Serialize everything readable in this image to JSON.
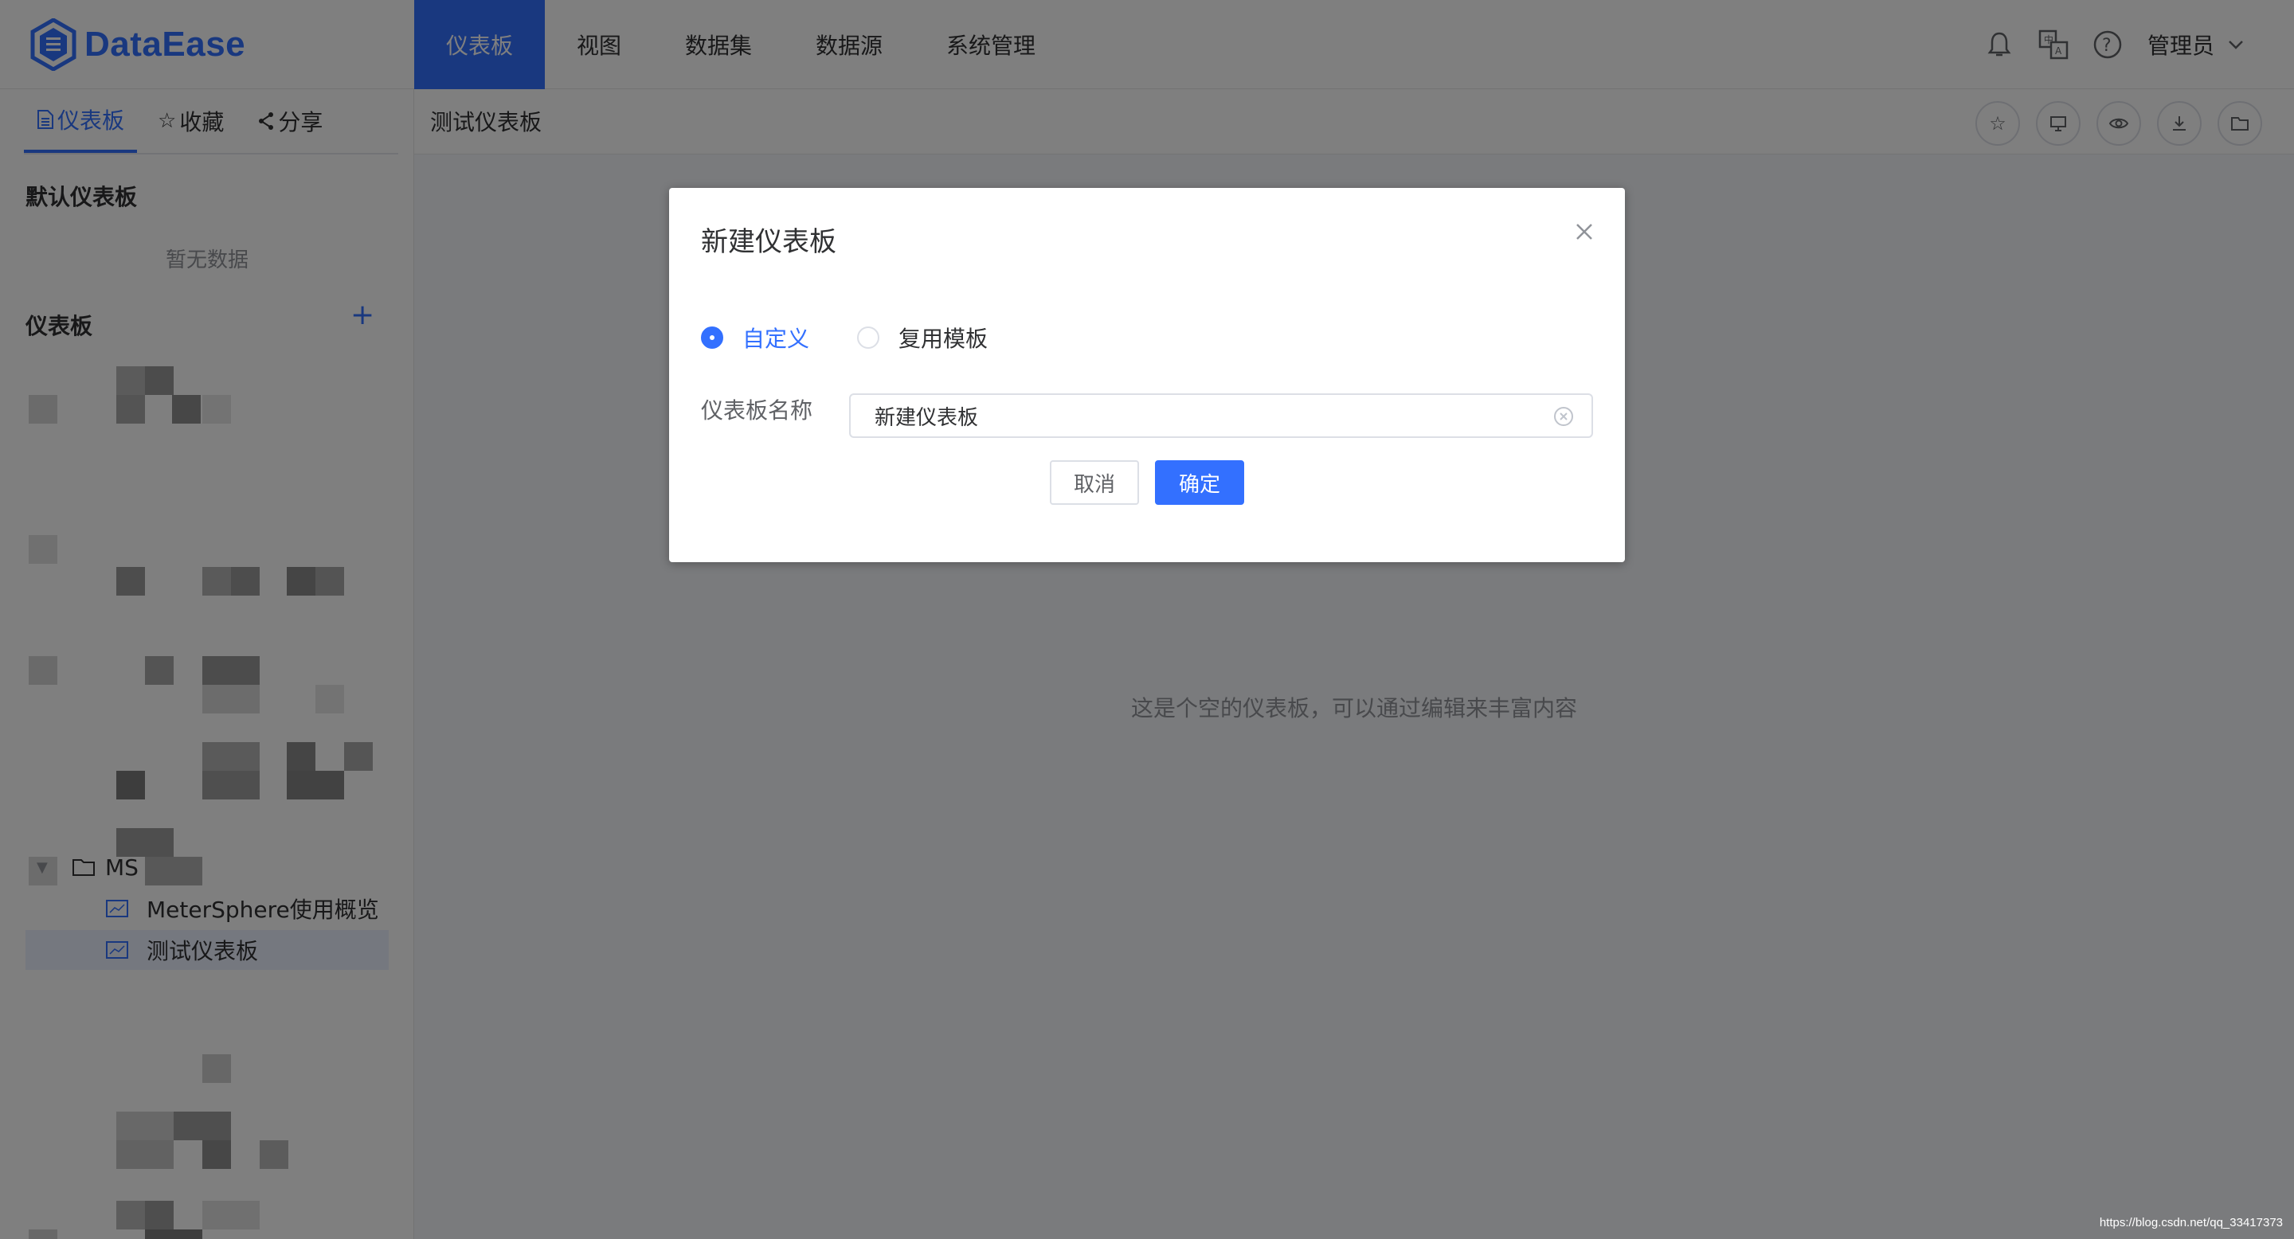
{
  "app": {
    "logo_text": "DataEase"
  },
  "topnav": {
    "items": [
      {
        "label": "仪表板",
        "active": true
      },
      {
        "label": "视图"
      },
      {
        "label": "数据集"
      },
      {
        "label": "数据源"
      },
      {
        "label": "系统管理"
      }
    ],
    "user": "管理员",
    "icons": [
      "bell-icon",
      "translate-icon",
      "help-icon"
    ]
  },
  "sidebar": {
    "tabs": [
      {
        "icon": "document-icon",
        "label": "仪表板",
        "active": true
      },
      {
        "icon": "star-icon",
        "label": "收藏"
      },
      {
        "icon": "share-icon",
        "label": "分享"
      }
    ],
    "default_title": "默认仪表板",
    "default_empty": "暂无数据",
    "panel_title": "仪表板",
    "add_symbol": "+",
    "tree": {
      "folder": "MS",
      "items": [
        {
          "label": "MeterSphere使用概览"
        },
        {
          "label": "测试仪表板",
          "selected": true
        }
      ]
    }
  },
  "main": {
    "title": "测试仪表板",
    "tool_icons": [
      "star-icon",
      "present-icon",
      "eye-icon",
      "download-icon",
      "folder-icon"
    ],
    "empty_text": "这是个空的仪表板，可以通过编辑来丰富内容"
  },
  "dialog": {
    "title": "新建仪表板",
    "radio_options": [
      {
        "label": "自定义",
        "checked": true
      },
      {
        "label": "复用模板",
        "checked": false
      }
    ],
    "name_label": "仪表板名称",
    "name_value": "新建仪表板",
    "cancel_label": "取消",
    "confirm_label": "确定"
  },
  "watermark": "https://blog.csdn.net/qq_33417373",
  "colors": {
    "primary": "#3370ff",
    "overlay": "rgba(0,0,0,0.5)"
  }
}
